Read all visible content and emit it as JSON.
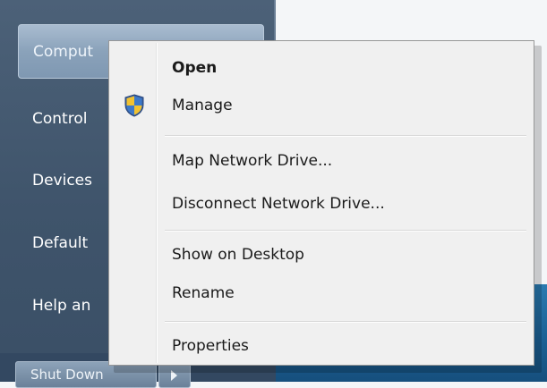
{
  "start_menu": {
    "items": [
      {
        "label": "Comput"
      },
      {
        "label": "Control"
      },
      {
        "label": "Devices"
      },
      {
        "label": "Default"
      },
      {
        "label": "Help an"
      }
    ],
    "shutdown_label": "Shut Down"
  },
  "context_menu": {
    "items": [
      {
        "label": "Open"
      },
      {
        "label": "Manage",
        "icon": "uac-shield-icon"
      },
      {
        "label": "Map Network Drive..."
      },
      {
        "label": "Disconnect Network Drive..."
      },
      {
        "label": "Show on Desktop"
      },
      {
        "label": "Rename"
      },
      {
        "label": "Properties"
      }
    ]
  },
  "colors": {
    "start_pane": "#4c6178",
    "menu_background": "#f0f0f0",
    "desktop_blue": "#1b5f93"
  }
}
